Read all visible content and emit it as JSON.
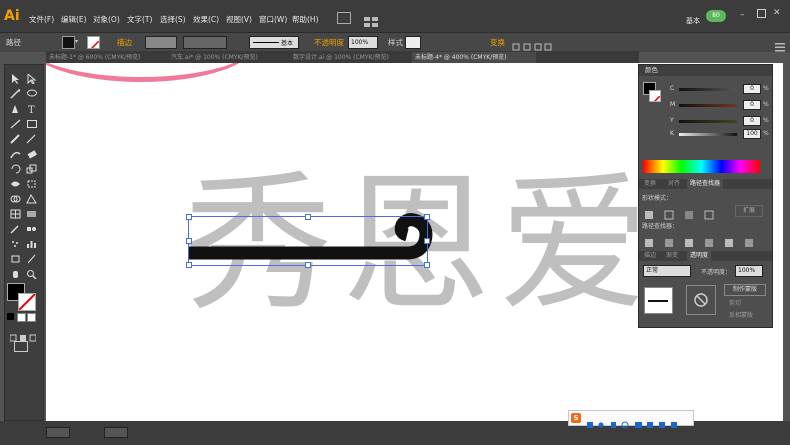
{
  "app": {
    "logo": "Ai"
  },
  "menu": {
    "items": [
      "文件(F)",
      "编辑(E)",
      "对象(O)",
      "文字(T)",
      "选择(S)",
      "效果(C)",
      "视图(V)",
      "窗口(W)",
      "帮助(H)"
    ],
    "workspace": "基本",
    "badge": "80"
  },
  "options": {
    "path_label": "路径",
    "stroke_label": "描边",
    "basic_label": "基本",
    "opacity_label": "不透明度",
    "opacity_value": "100%",
    "style_label": "样式",
    "transform_label": "变换"
  },
  "tabs": [
    {
      "label": "未标题-1* @ 600% (CMYK/预览)",
      "active": false
    },
    {
      "label": "汽车.ai* @ 100% (CMYK/预览)",
      "active": false
    },
    {
      "label": "数字设计.ai @ 100% (CMYK/预览)",
      "active": false
    },
    {
      "label": "未标题-4* @ 400% (CMYK/预览)",
      "active": true
    }
  ],
  "canvas": {
    "ghost_text": "秀恩爱"
  },
  "color_panel": {
    "title": "颜色",
    "channels": [
      {
        "name": "C",
        "value": "0"
      },
      {
        "name": "M",
        "value": "0"
      },
      {
        "name": "Y",
        "value": "0"
      },
      {
        "name": "K",
        "value": "100"
      }
    ],
    "percent": "%"
  },
  "pathfinder_panel": {
    "tabs": [
      "变换",
      "对齐",
      "路径查找器"
    ],
    "shape_modes": "形状模式：",
    "expand": "扩展",
    "pathfinders": "路径查找器："
  },
  "transparency_panel": {
    "tabs": [
      "描边",
      "渐变",
      "透明度"
    ],
    "blend_mode": "正常",
    "opacity_label": "不透明度：",
    "opacity_value": "100%",
    "make_mask": "制作蒙版",
    "clip": "剪切",
    "invert_mask": "反相蒙版"
  },
  "colors": {
    "accent_orange": "#f29f00",
    "stroke_black": "#111111",
    "selection_blue": "#4a6fdc",
    "pink": "#f07a9a"
  }
}
